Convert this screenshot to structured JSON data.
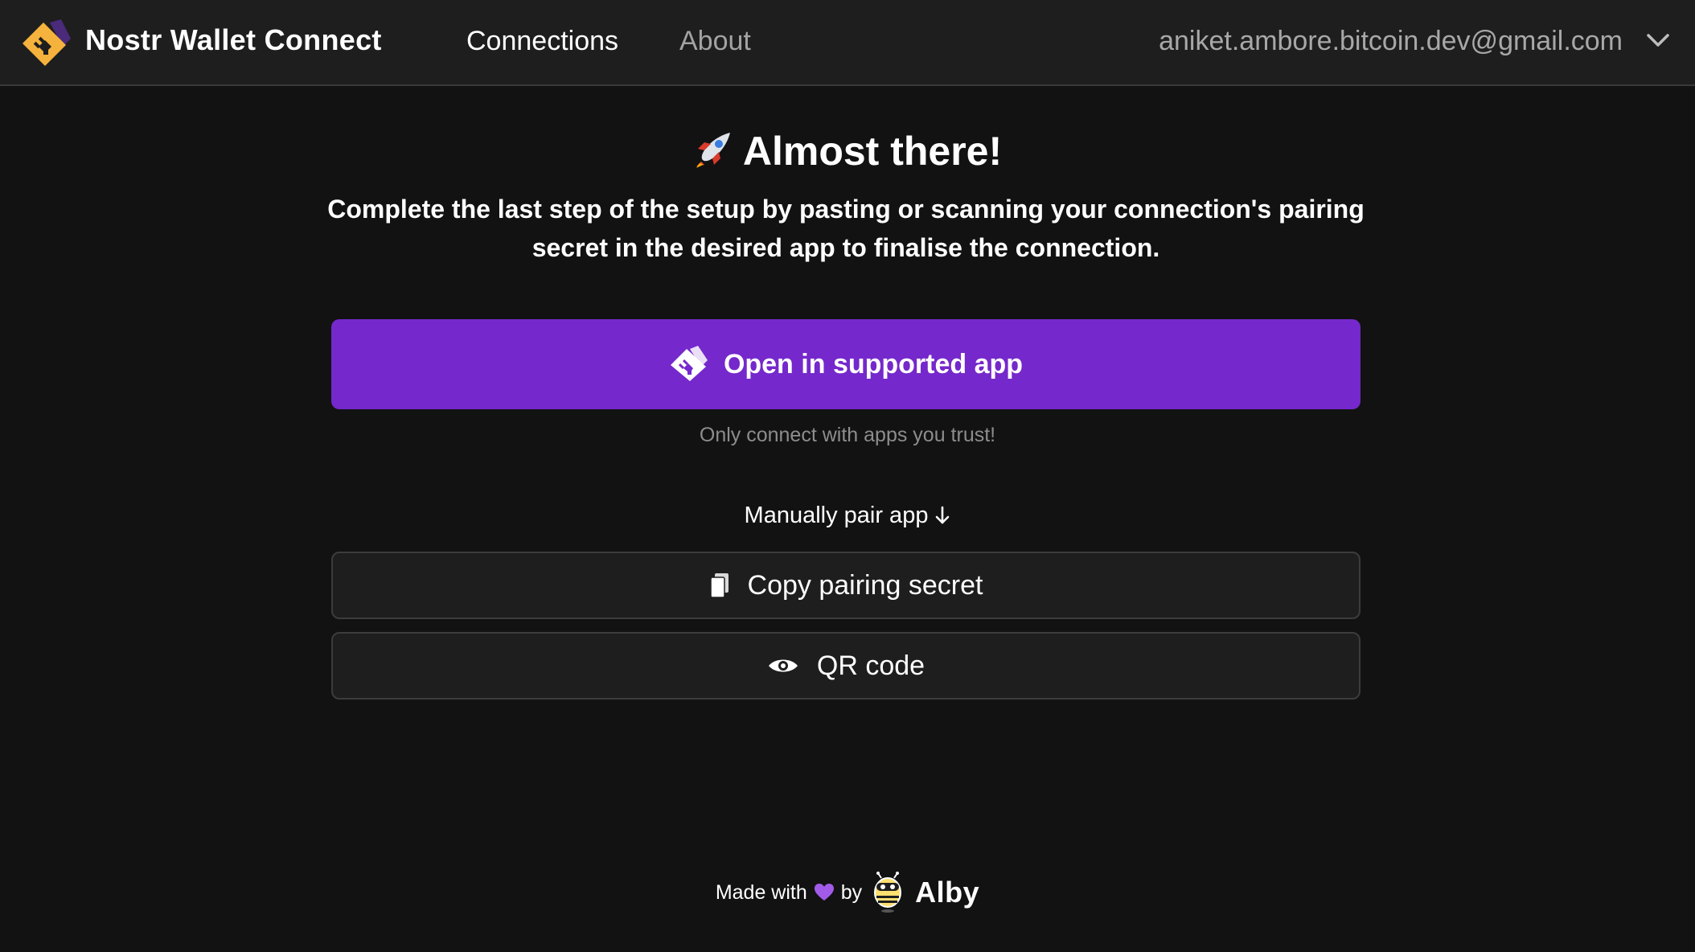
{
  "header": {
    "brand": "Nostr Wallet Connect",
    "logo_icon": "nwc-logo-icon",
    "nav": [
      {
        "label": "Connections",
        "active": true
      },
      {
        "label": "About",
        "active": false
      }
    ],
    "account_email": "aniket.ambore.bitcoin.dev@gmail.com",
    "account_chevron_icon": "chevron-down-icon"
  },
  "main": {
    "title_icon": "rocket-icon",
    "title": "Almost there!",
    "intro": "Complete the last step of the setup by pasting or scanning your connection's pairing secret in the desired app to finalise the connection.",
    "open_button": {
      "label": "Open in supported app",
      "icon": "nwc-logo-icon"
    },
    "trust_note": "Only connect with apps you trust!",
    "manual_label": "Manually pair app",
    "manual_icon": "arrow-down-icon",
    "copy_button": {
      "label": "Copy pairing secret",
      "icon": "copy-icon"
    },
    "qr_button": {
      "label": "QR code",
      "icon": "eye-icon"
    }
  },
  "footer": {
    "made_with": "Made with",
    "heart_icon": "purple-heart-icon",
    "by": "by",
    "brand": "Alby",
    "brand_icon": "alby-bee-icon"
  },
  "colors": {
    "background": "#121212",
    "header_bg": "#1e1e1e",
    "primary": "#7528cb",
    "logo_yellow": "#f5b23c",
    "muted_text": "#8d8d8d"
  }
}
